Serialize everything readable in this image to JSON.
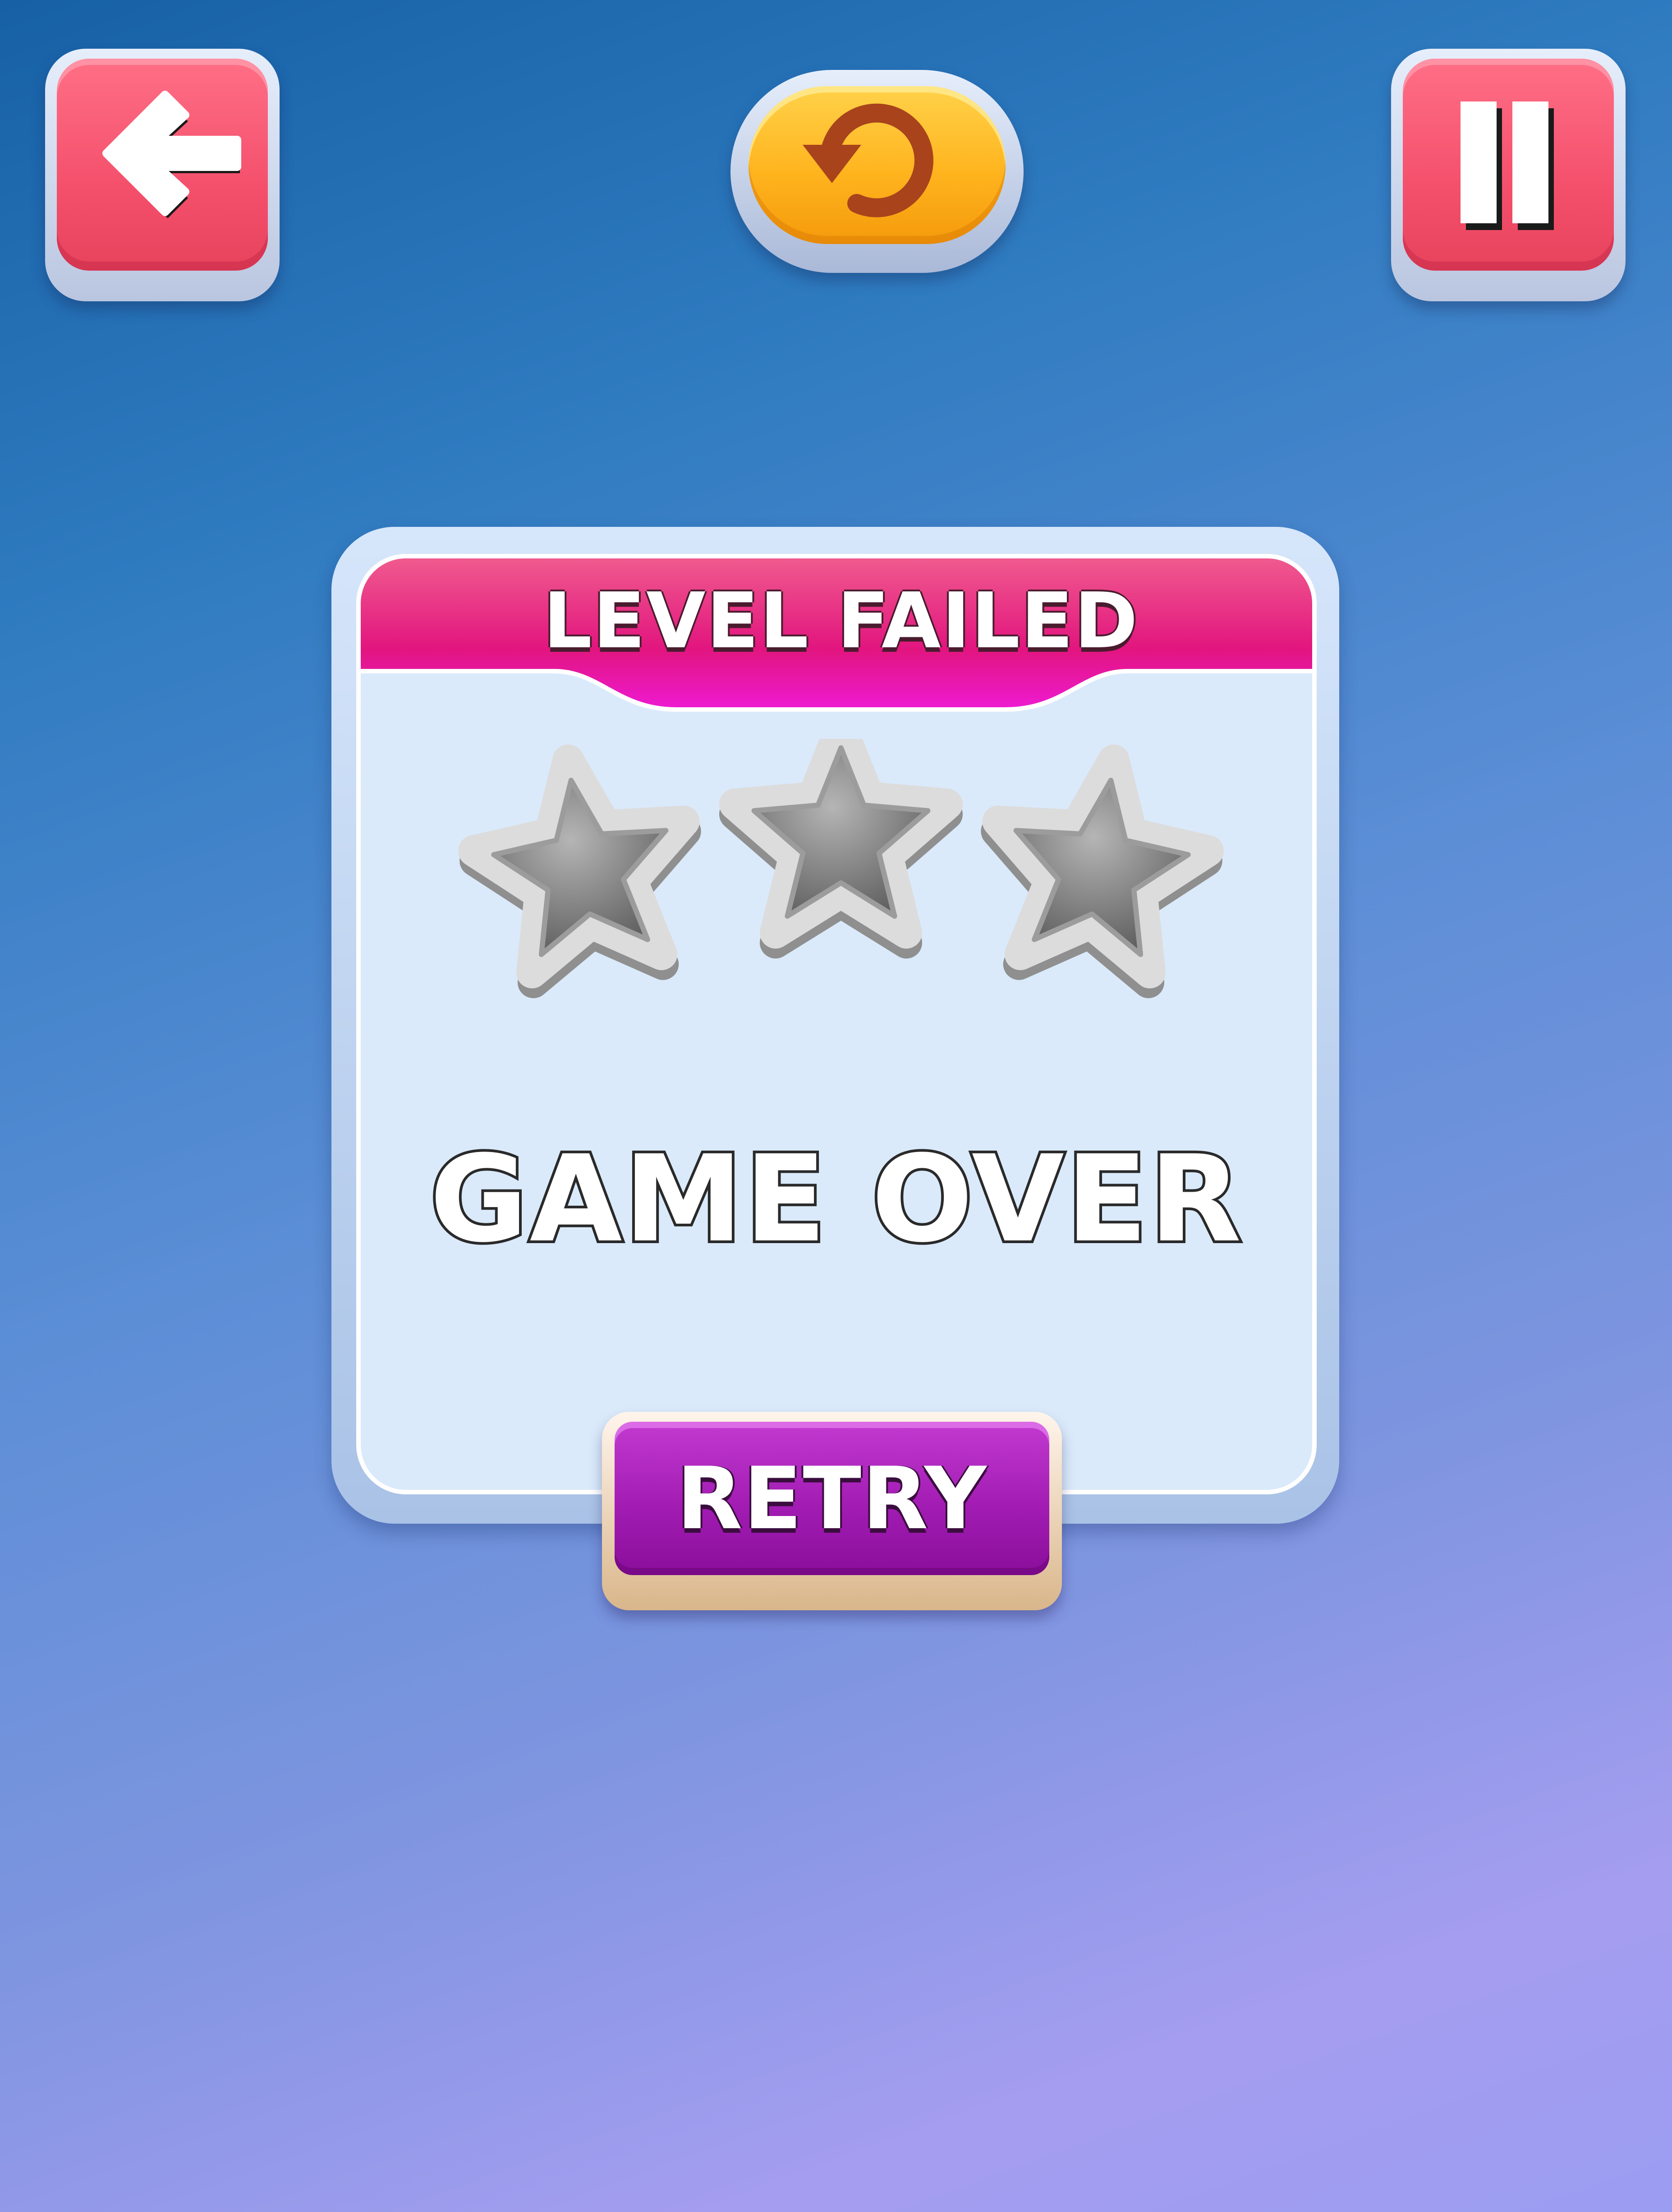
{
  "top_bar": {
    "back_button": {
      "icon": "arrow-left-icon",
      "color": "#f4506c"
    },
    "restart_button": {
      "icon": "restart-icon",
      "color": "#ffb41e"
    },
    "pause_button": {
      "icon": "pause-icon",
      "color": "#f4506c"
    }
  },
  "dialog": {
    "title": "LEVEL FAILED",
    "title_color": "#e2157f",
    "stars": {
      "earned": 0,
      "total": 3
    },
    "message": "GAME OVER",
    "retry_label": "RETRY",
    "retry_color": "#a21cb3"
  }
}
